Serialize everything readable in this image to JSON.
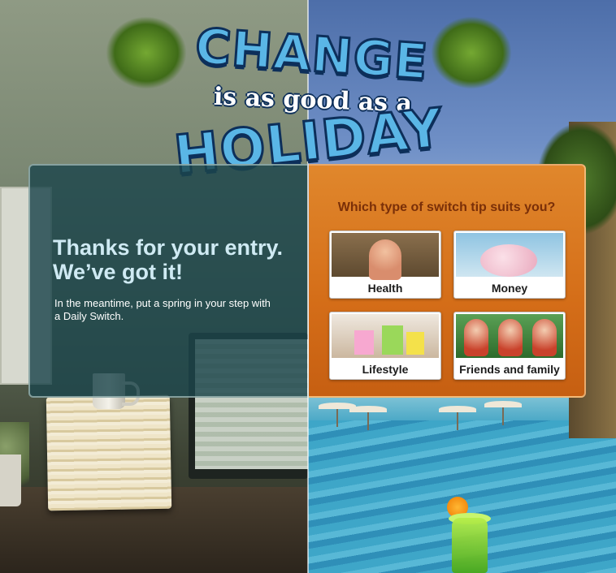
{
  "headline": {
    "word1": "CHANGE",
    "word2": "is as good as a",
    "word3": "HOLIDAY"
  },
  "confirmation": {
    "title_line1": "Thanks for your entry.",
    "title_line2": "We’ve got it!",
    "body": "In the meantime, put a spring in your step with a Daily Switch."
  },
  "switch_tips": {
    "question": "Which type of switch tip suits you?",
    "tiles": [
      {
        "label": "Health",
        "image": "health-photo"
      },
      {
        "label": "Money",
        "image": "piggy-bank-photo"
      },
      {
        "label": "Lifestyle",
        "image": "shopping-bags-photo"
      },
      {
        "label": "Friends and family",
        "image": "children-photo"
      }
    ]
  },
  "colors": {
    "left_panel": "#1c464c",
    "right_panel": "#d46d18",
    "question_text": "#7a2f08",
    "thanks_text": "#cfeaf3",
    "headline_fill": "#5ab6e6",
    "headline_outline": "#0d2f5a"
  }
}
